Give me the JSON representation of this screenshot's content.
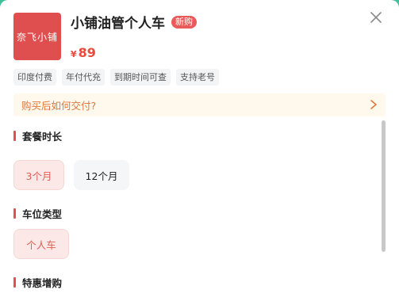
{
  "product": {
    "logo_text": "奈飞小铺",
    "title": "小铺油管个人车",
    "badge": "新购",
    "price_currency": "¥",
    "price_value": "89"
  },
  "tags": [
    "印度付费",
    "年付代充",
    "到期时间可查",
    "支持老号"
  ],
  "notice": {
    "text": "购买后如何交付?"
  },
  "sections": {
    "plan": {
      "title": "套餐时长",
      "options": [
        {
          "label": "3个月",
          "selected": true
        },
        {
          "label": "12个月",
          "selected": false
        }
      ]
    },
    "seat": {
      "title": "车位类型",
      "options": [
        {
          "label": "个人车",
          "selected": true
        }
      ]
    },
    "addon": {
      "title": "特惠增购"
    }
  },
  "colors": {
    "accent": "#e04f4f",
    "price": "#e74c3c",
    "notice_text": "#e0793c",
    "notice_bg": "#fff8ec",
    "selected_bg": "#fce8e6",
    "backdrop": "#3fbf9a"
  },
  "icons": {
    "close": "close-icon",
    "notice_arrow": "chevron-right-icon"
  }
}
